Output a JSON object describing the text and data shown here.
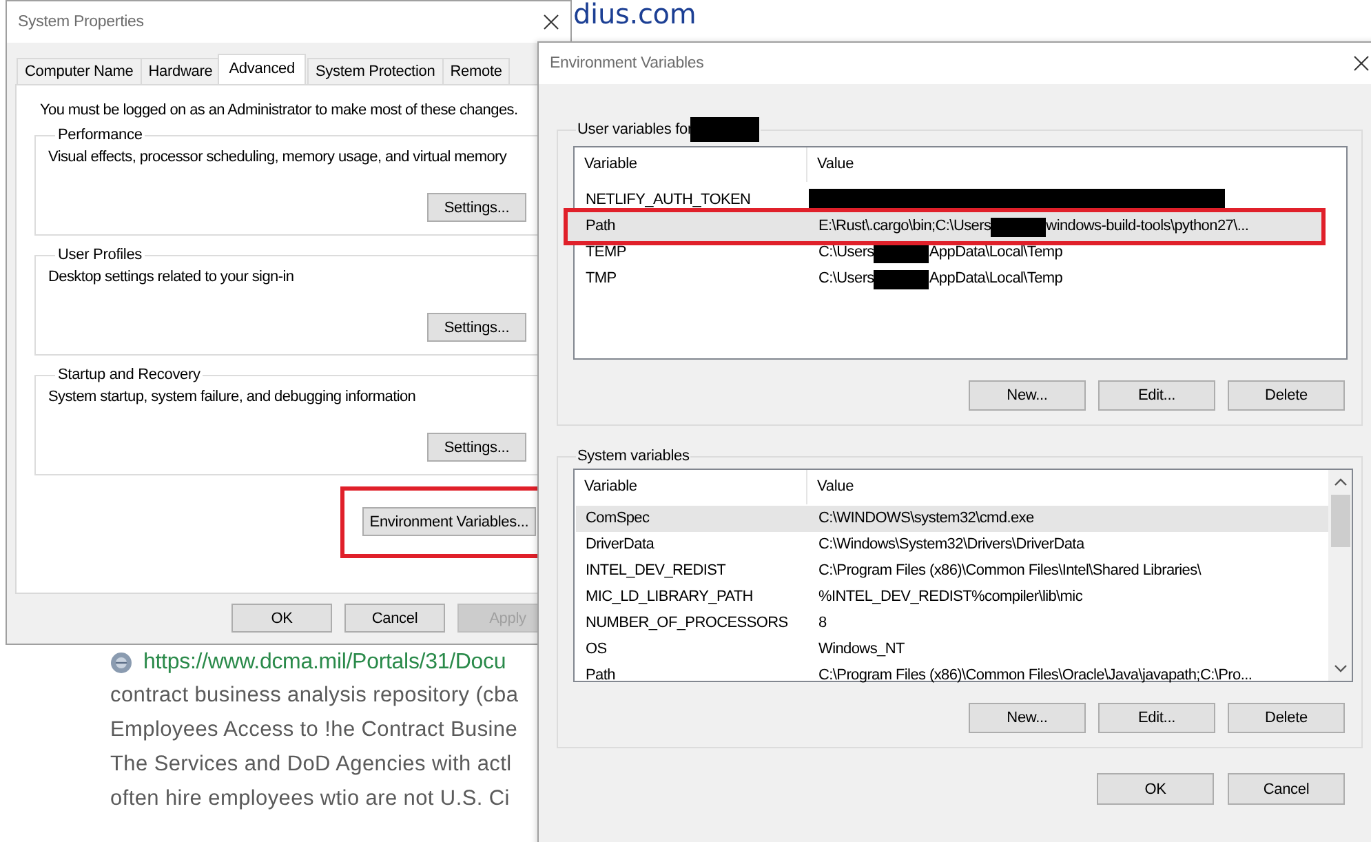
{
  "background_page": {
    "heading": "dius.com",
    "link": "https://www.dcma.mil/Portals/31/Docu",
    "lines": [
      "contract business analysis repository (cba",
      "Employees Access to !he Contract Busine",
      "The Services and DoD Agencies with actl",
      "often hire employees wtio are not U.S. Ci"
    ]
  },
  "system_properties": {
    "title": "System Properties",
    "tabs": [
      {
        "label": "Computer Name",
        "selected": false
      },
      {
        "label": "Hardware",
        "selected": false
      },
      {
        "label": "Advanced",
        "selected": true
      },
      {
        "label": "System Protection",
        "selected": false
      },
      {
        "label": "Remote",
        "selected": false
      }
    ],
    "notice": "You must be logged on as an Administrator to make most of these changes.",
    "groups": [
      {
        "title": "Performance",
        "description": "Visual effects, processor scheduling, memory usage, and virtual memory",
        "button": "Settings..."
      },
      {
        "title": "User Profiles",
        "description": "Desktop settings related to your sign-in",
        "button": "Settings..."
      },
      {
        "title": "Startup and Recovery",
        "description": "System startup, system failure, and debugging information",
        "button": "Settings..."
      }
    ],
    "env_button": {
      "label": "Environment Variables...",
      "highlighted": true
    },
    "buttons": [
      {
        "label": "OK",
        "disabled": false
      },
      {
        "label": "Cancel",
        "disabled": false
      },
      {
        "label": "Apply",
        "disabled": true
      }
    ]
  },
  "environment_variables": {
    "title": "Environment Variables",
    "user_variables": {
      "title": "User variables for",
      "title_redacted": true,
      "columns": [
        "Variable",
        "Value"
      ],
      "scrollable": false,
      "rows": [
        {
          "variable": "NETLIFY_AUTH_TOKEN",
          "value": [
            {
              "kind": "token-redaction"
            }
          ],
          "selected": false,
          "highlighted": false
        },
        {
          "variable": "Path",
          "value": [
            {
              "kind": "text",
              "text": "E:\\Rust\\.cargo\\bin;C:\\Users"
            },
            {
              "kind": "name-redaction"
            },
            {
              "kind": "text",
              "text": "windows-build-tools\\python27\\..."
            }
          ],
          "selected": true,
          "highlighted": true
        },
        {
          "variable": "TEMP",
          "value": [
            {
              "kind": "text",
              "text": "C:\\Users"
            },
            {
              "kind": "name-redaction"
            },
            {
              "kind": "text",
              "text": "AppData\\Local\\Temp"
            }
          ],
          "selected": false,
          "highlighted": false
        },
        {
          "variable": "TMP",
          "value": [
            {
              "kind": "text",
              "text": "C:\\Users"
            },
            {
              "kind": "name-redaction"
            },
            {
              "kind": "text",
              "text": "AppData\\Local\\Temp"
            }
          ],
          "selected": false,
          "highlighted": false
        }
      ],
      "buttons": [
        "New...",
        "Edit...",
        "Delete"
      ]
    },
    "system_variables": {
      "title": "System variables",
      "title_redacted": false,
      "columns": [
        "Variable",
        "Value"
      ],
      "scrollable": true,
      "rows": [
        {
          "variable": "ComSpec",
          "value": [
            {
              "kind": "text",
              "text": "C:\\WINDOWS\\system32\\cmd.exe"
            }
          ],
          "selected": true,
          "highlighted": false
        },
        {
          "variable": "DriverData",
          "value": [
            {
              "kind": "text",
              "text": "C:\\Windows\\System32\\Drivers\\DriverData"
            }
          ],
          "selected": false,
          "highlighted": false
        },
        {
          "variable": "INTEL_DEV_REDIST",
          "value": [
            {
              "kind": "text",
              "text": "C:\\Program Files (x86)\\Common Files\\Intel\\Shared Libraries\\"
            }
          ],
          "selected": false,
          "highlighted": false
        },
        {
          "variable": "MIC_LD_LIBRARY_PATH",
          "value": [
            {
              "kind": "text",
              "text": "%INTEL_DEV_REDIST%compiler\\lib\\mic"
            }
          ],
          "selected": false,
          "highlighted": false
        },
        {
          "variable": "NUMBER_OF_PROCESSORS",
          "value": [
            {
              "kind": "text",
              "text": "8"
            }
          ],
          "selected": false,
          "highlighted": false
        },
        {
          "variable": "OS",
          "value": [
            {
              "kind": "text",
              "text": "Windows_NT"
            }
          ],
          "selected": false,
          "highlighted": false
        },
        {
          "variable": "Path",
          "value": [
            {
              "kind": "text",
              "text": "C:\\Program Files (x86)\\Common Files\\Oracle\\Java\\javapath;C:\\Pro..."
            }
          ],
          "selected": false,
          "highlighted": false
        }
      ],
      "buttons": [
        "New...",
        "Edit...",
        "Delete"
      ]
    },
    "buttons": [
      "OK",
      "Cancel"
    ]
  }
}
